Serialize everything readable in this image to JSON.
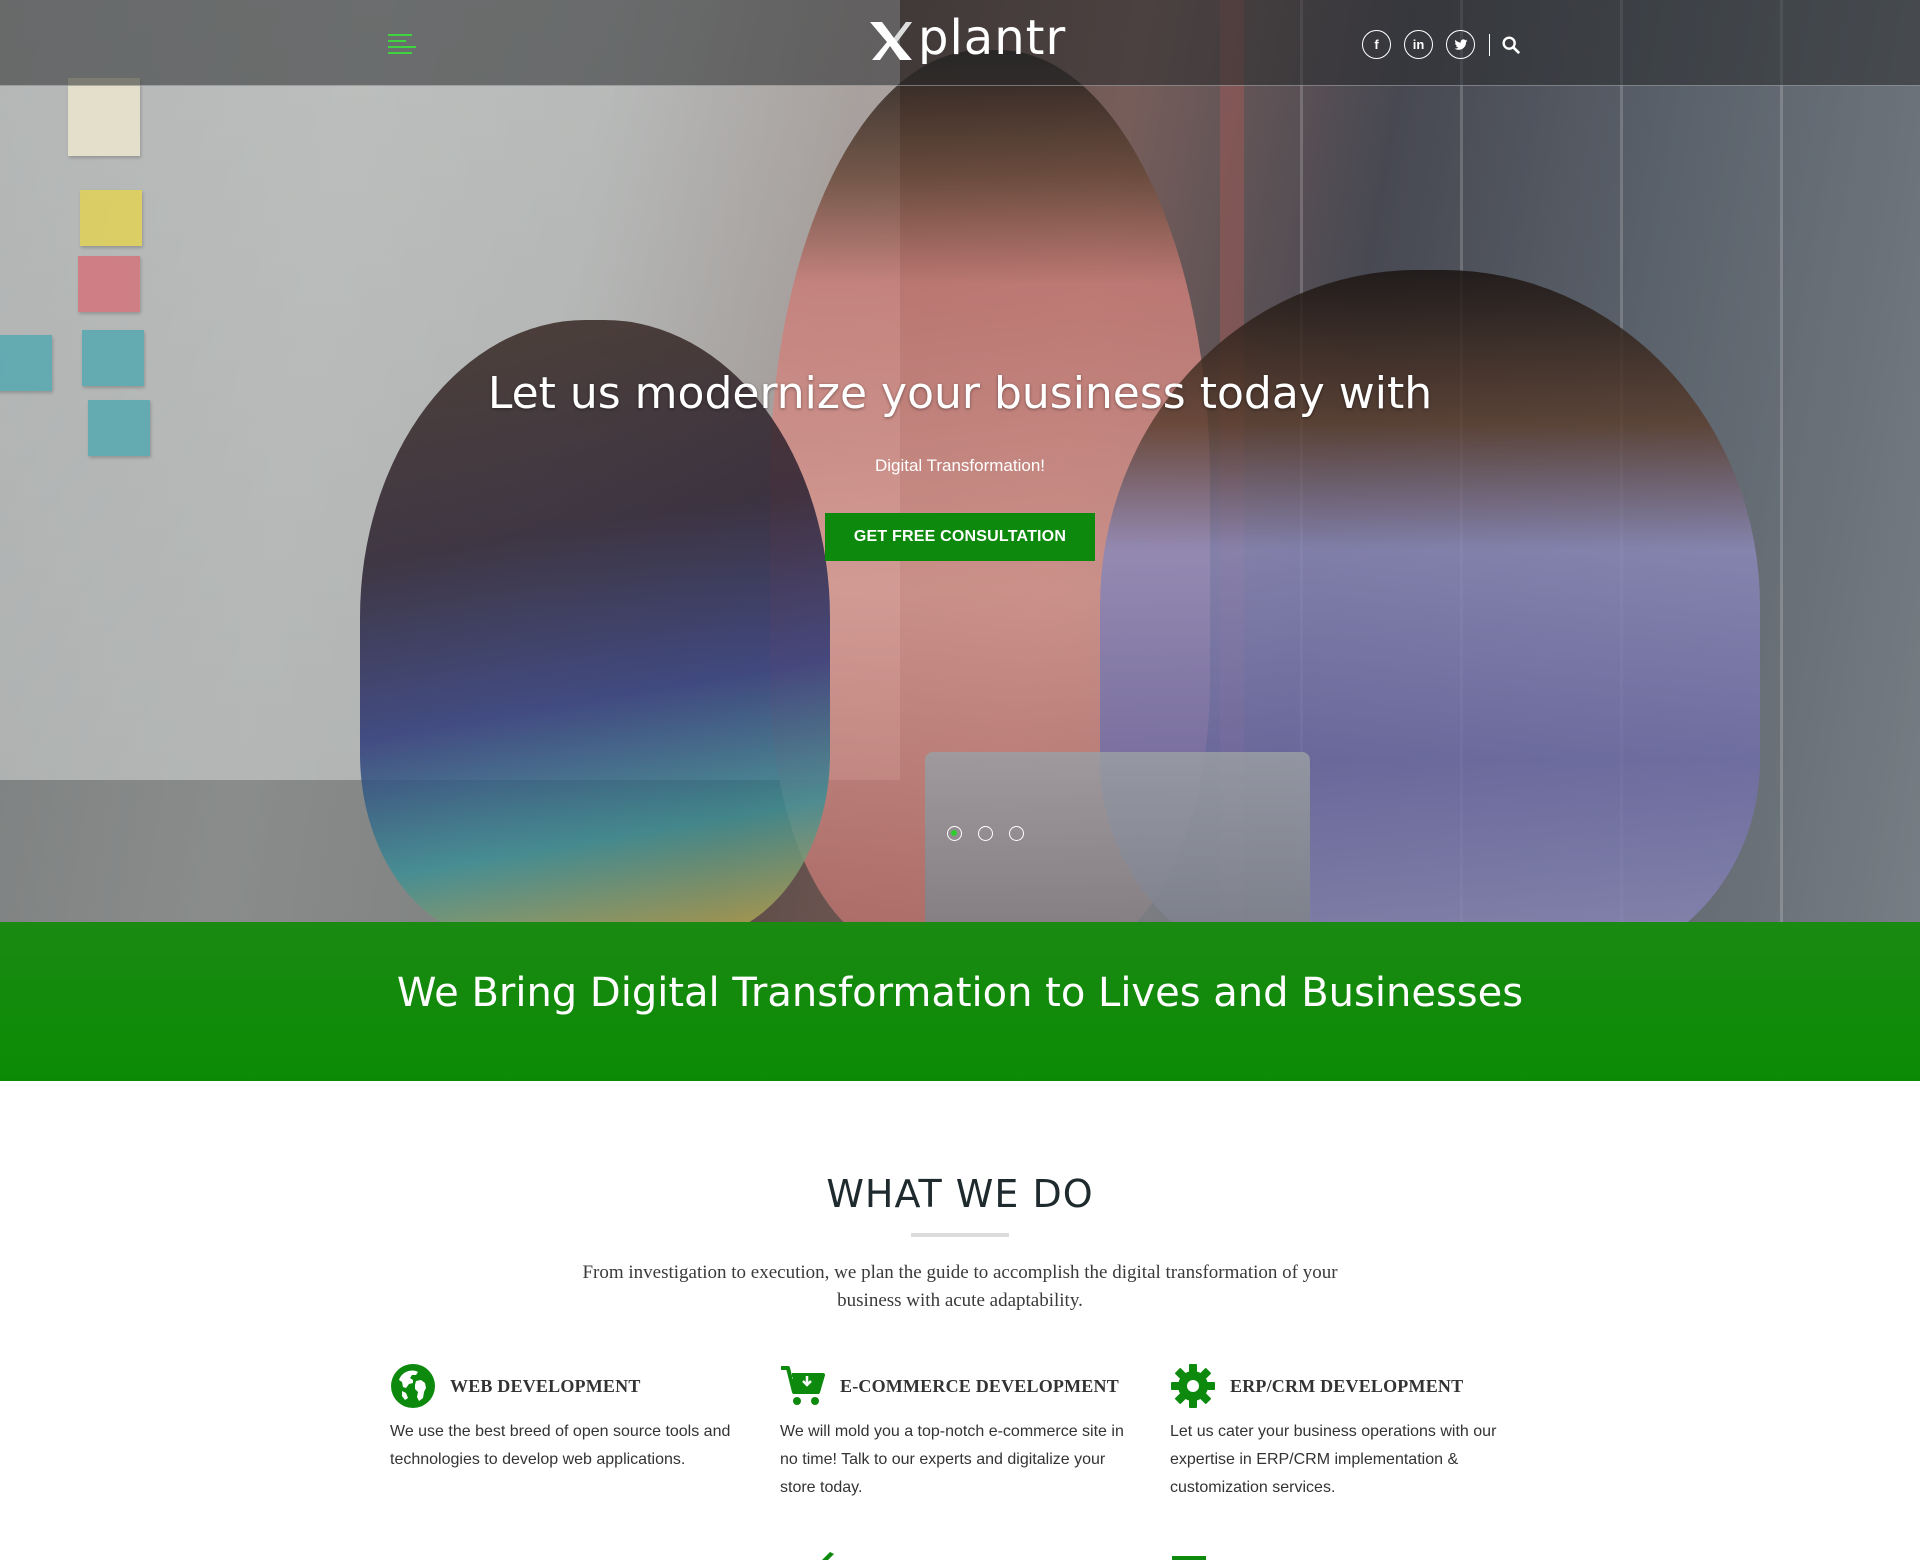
{
  "brand": {
    "logo_text": "plantr",
    "accent": "#0d8a0d"
  },
  "nav": {
    "social": [
      {
        "icon": "facebook-icon",
        "glyph": "f"
      },
      {
        "icon": "linkedin-icon",
        "glyph": "in"
      },
      {
        "icon": "twitter-icon",
        "glyph": "t"
      }
    ]
  },
  "hero": {
    "title": "Let us modernize your business today with",
    "subtitle": "Digital Transformation!",
    "cta_label": "GET FREE CONSULTATION",
    "slide_count": 3,
    "active_slide": 1
  },
  "band": {
    "text": "We Bring Digital Transformation to Lives and Businesses"
  },
  "what_we_do": {
    "title": "WHAT WE DO",
    "description": "From investigation to execution, we plan the guide to accomplish the digital transformation of your business with acute adaptability.",
    "services": [
      {
        "icon": "globe-icon",
        "title": "WEB DEVELOPMENT",
        "text": "We use the best breed of open source tools and technologies to develop web applications."
      },
      {
        "icon": "shopping-cart-icon",
        "title": "E-COMMERCE DEVELOPMENT",
        "text": "We will mold you a top-notch e-commerce site in no time! Talk to our experts and digitalize your store today."
      },
      {
        "icon": "gear-icon",
        "title": "ERP/CRM DEVELOPMENT",
        "text": "Let us cater your business operations with our expertise in ERP/CRM implementation & customization services."
      }
    ]
  }
}
